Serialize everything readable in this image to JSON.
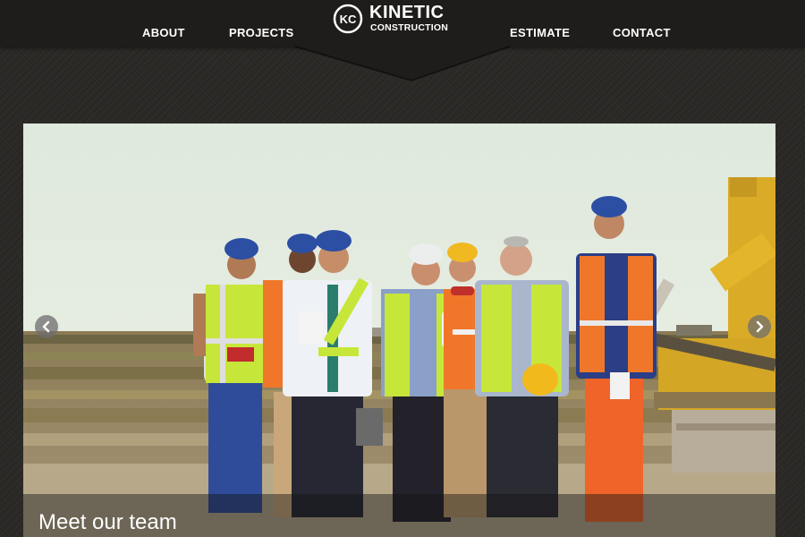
{
  "brand": {
    "monogram": "KC",
    "name": "KINETIC",
    "subtitle": "CONSTRUCTION"
  },
  "nav": {
    "about": "ABOUT",
    "projects": "PROJECTS",
    "estimate": "ESTIMATE",
    "contact": "CONTACT"
  },
  "hero": {
    "caption": "Meet our team",
    "icons": {
      "prev": "chevron-left-icon",
      "next": "chevron-right-icon"
    }
  },
  "colors": {
    "background": "#2a2825",
    "header": "#1f1d1b",
    "text": "#ffffff",
    "sky": "#dde8dc",
    "vest_yellow": "#c7e63a",
    "vest_orange": "#f0772a",
    "machine_yellow": "#e2b52a"
  }
}
